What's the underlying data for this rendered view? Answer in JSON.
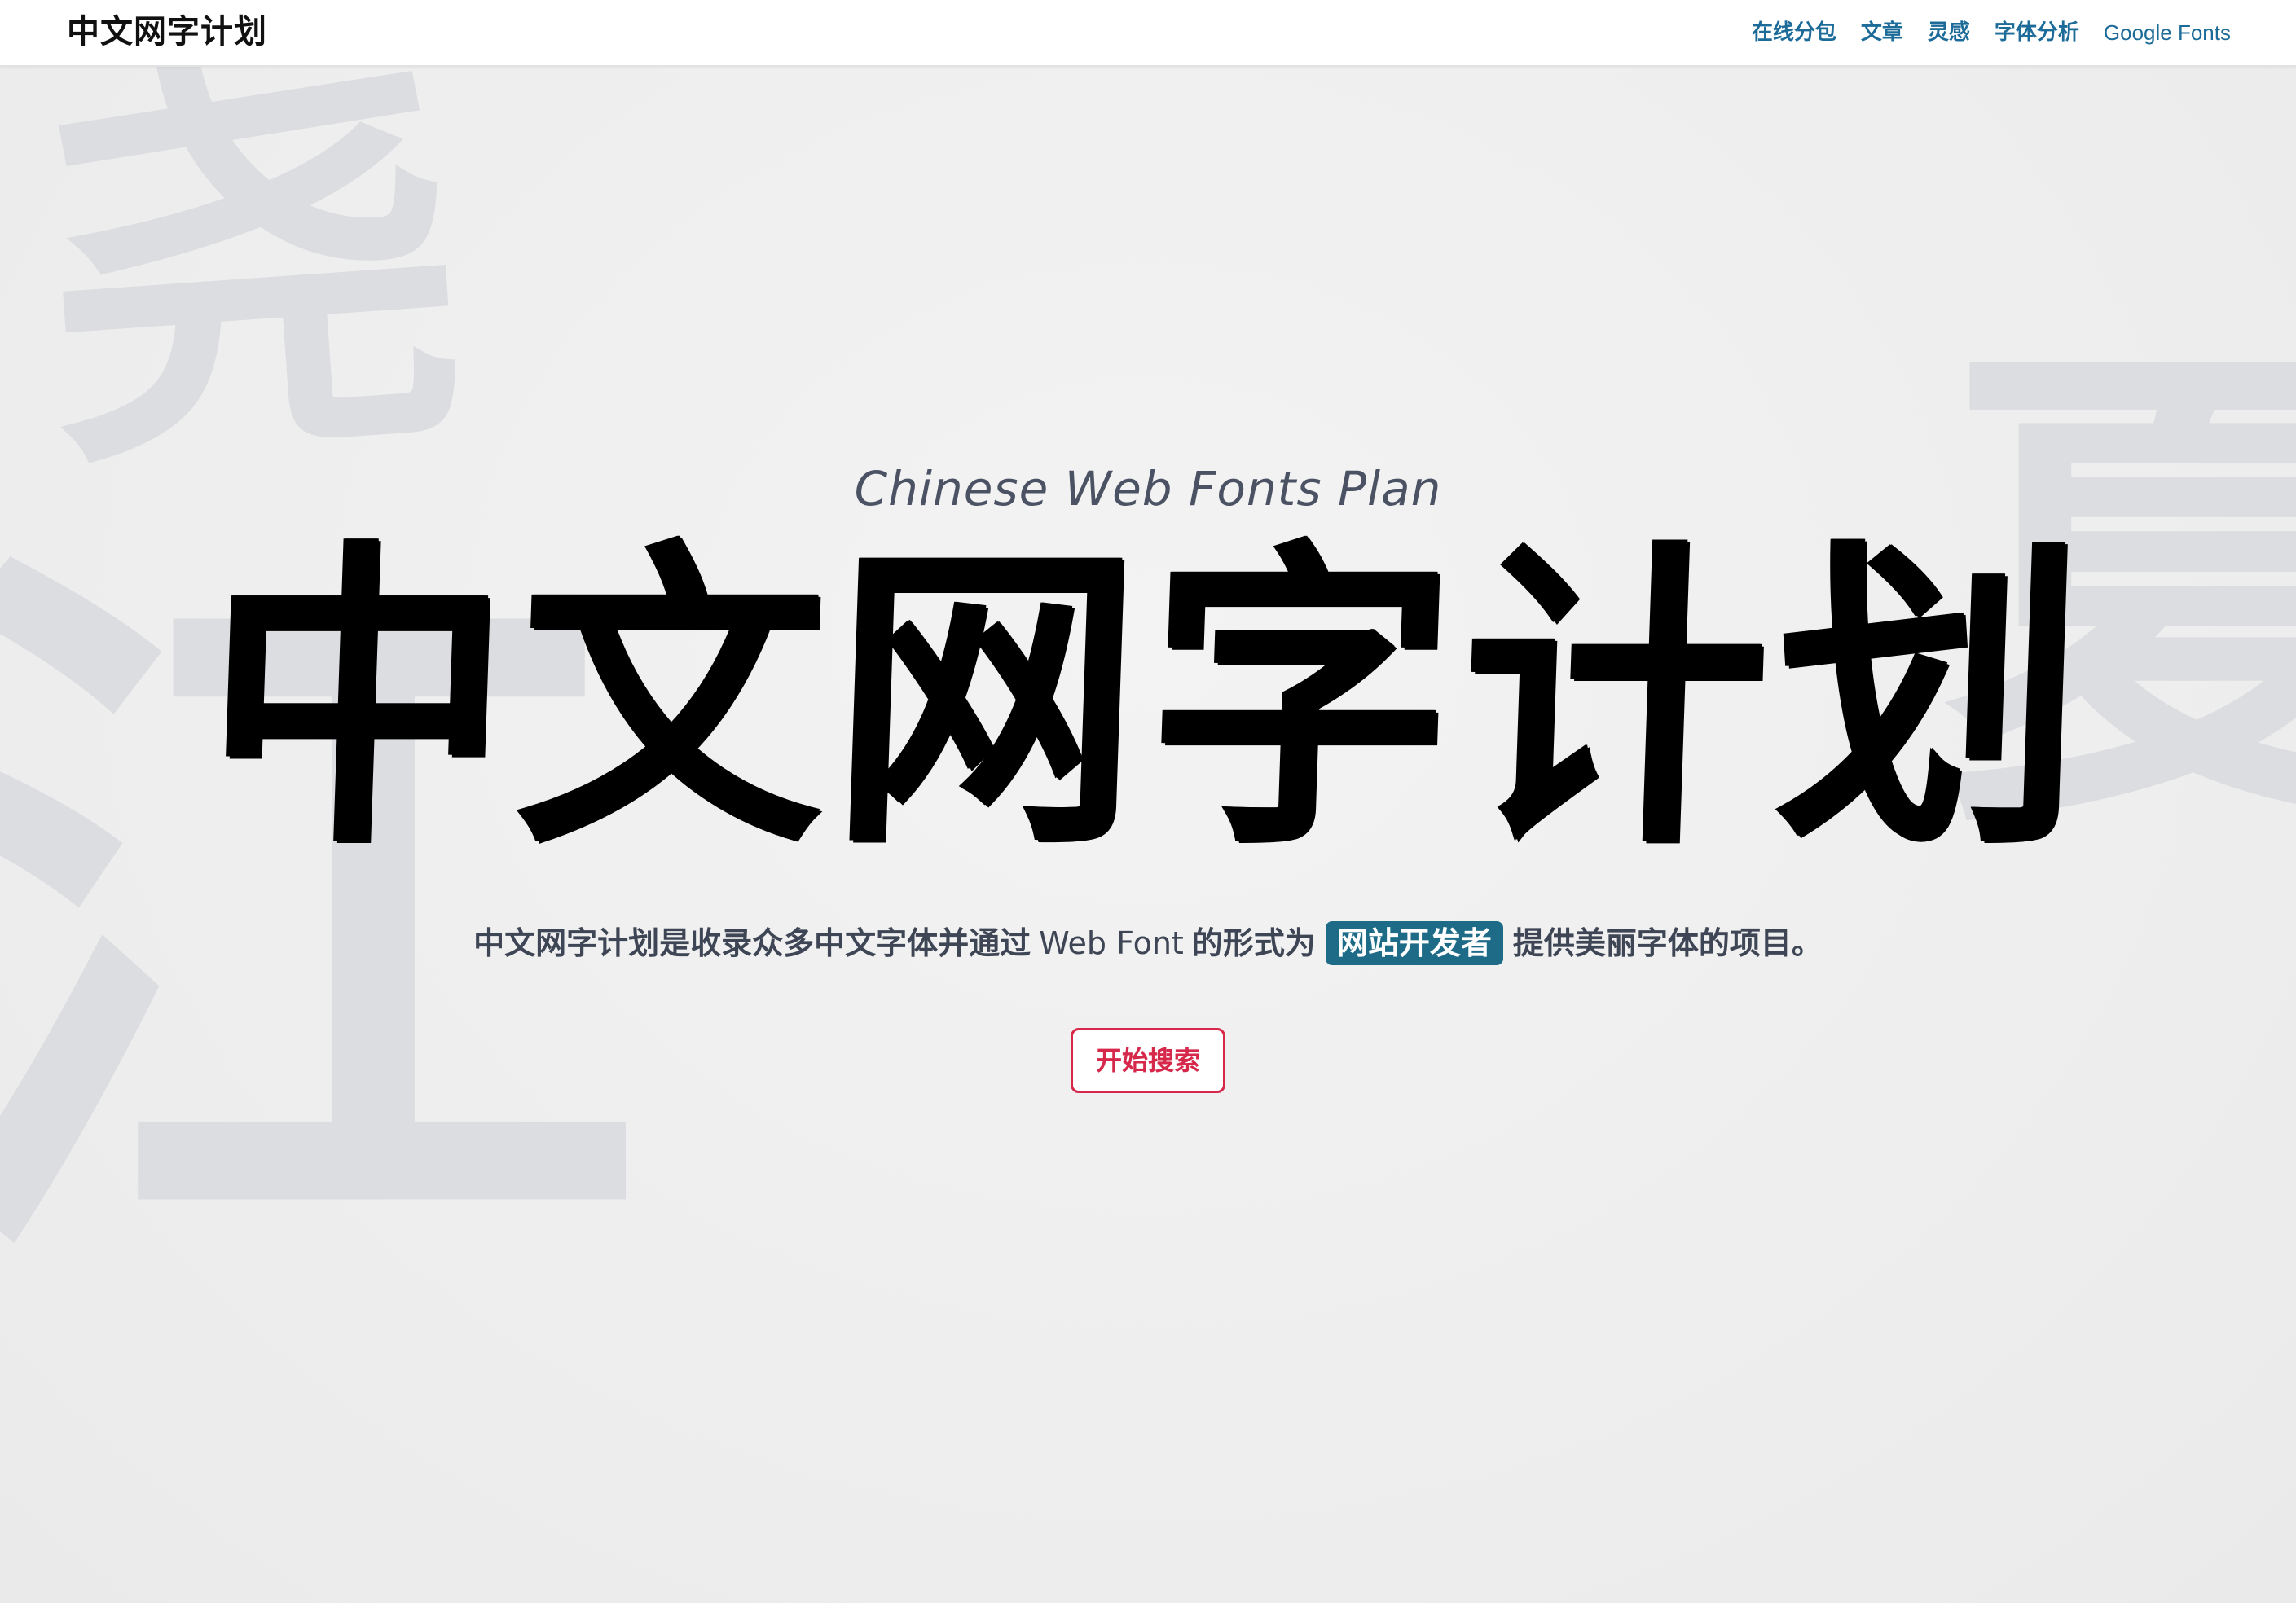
{
  "navbar": {
    "brand": "中文网字计划",
    "links": [
      {
        "label": "在线分包"
      },
      {
        "label": "文章"
      },
      {
        "label": "灵感"
      },
      {
        "label": "字体分析"
      },
      {
        "label": "Google Fonts"
      }
    ]
  },
  "background": {
    "glyphs": [
      "尧",
      "江",
      "夏"
    ]
  },
  "hero": {
    "subtitle": "Chinese Web Fonts Plan",
    "title": "中文网字计划",
    "description": {
      "part1": "中文网字计划是收录众多中文字体并通过",
      "latin": "Web Font",
      "part2": "的形式为",
      "highlight": "网站开发者",
      "part3": "提供美丽字体的项目。"
    },
    "cta_label": "开始搜索"
  },
  "colors": {
    "nav_link": "#1d6b99",
    "highlight_bg": "#1d6b87",
    "cta": "#d6284a",
    "bg_glyph": "#dcdde0",
    "text": "#3e4656"
  }
}
